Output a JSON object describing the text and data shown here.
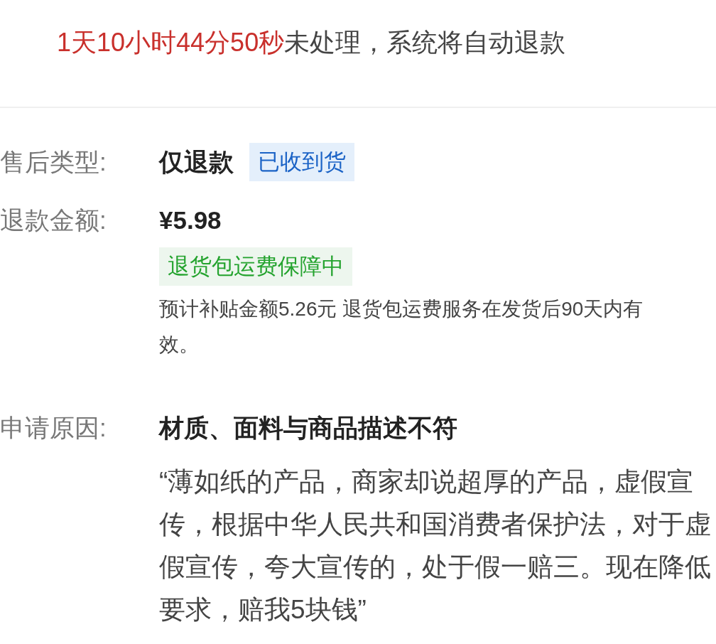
{
  "countdown": {
    "time": "1天10小时44分50秒",
    "message": "未处理，系统将自动退款"
  },
  "fields": [
    {
      "label": "售后类型:",
      "value": "仅退款",
      "tag": {
        "kind": "status",
        "text": "已收到货"
      }
    },
    {
      "label": "退款金额:",
      "value": "¥5.98",
      "tag": {
        "kind": "insurance",
        "text": "退货包运费保障中"
      },
      "note": "预计补贴金额5.26元 退货包运费服务在发货后90天内有效。"
    },
    {
      "label": "申请原因:",
      "value": "材质、面料与商品描述不符",
      "quote": "“薄如纸的产品，商家却说超厚的产品，虚假宣传，根据中华人民共和国消费者保护法，对于虚假宣传，夸大宣传的，处于假一赔三。现在降低要求，赔我5块钱”"
    }
  ]
}
